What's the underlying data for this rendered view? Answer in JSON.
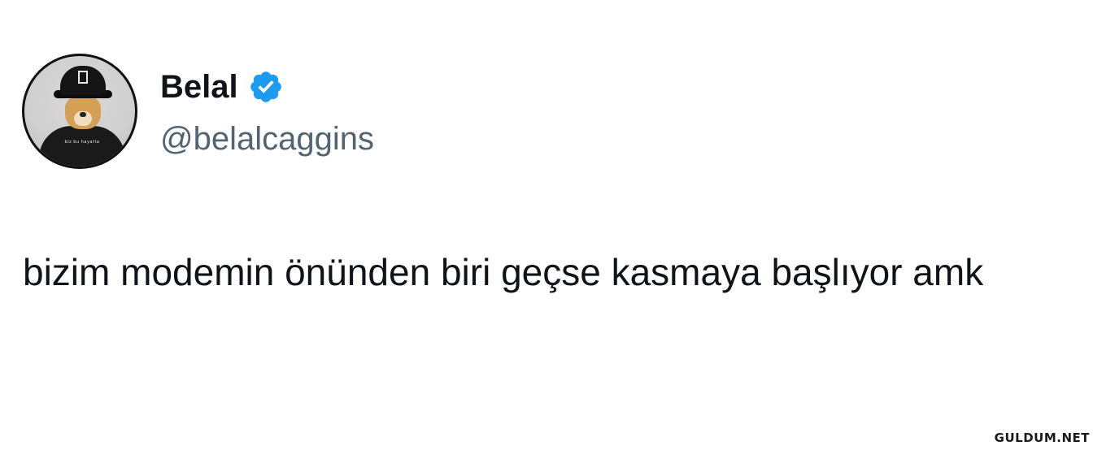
{
  "tweet": {
    "author": {
      "display_name": "Belal",
      "handle": "@belalcaggins",
      "verified": true,
      "avatar_icon": "avatar-dog-with-cap",
      "avatar_shirt_text": "biz bu hayatta"
    },
    "text": "bizim modemin önünden biri geçse kasmaya başlıyor amk"
  },
  "watermark": {
    "text": "GULDUM.NET"
  },
  "colors": {
    "text_primary": "#0f1419",
    "text_secondary": "#536471",
    "verified_blue": "#1d9bf0",
    "background": "#ffffff"
  }
}
